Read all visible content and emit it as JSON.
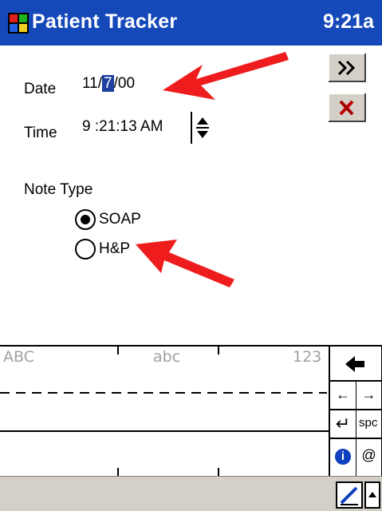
{
  "titlebar": {
    "title": "Patient Tracker",
    "clock": "9:21a",
    "icon": "windows-flag-icon"
  },
  "form": {
    "date_label": "Date",
    "date_month": "11/",
    "date_day": "7",
    "date_year": "/00",
    "time_label": "Time",
    "time_value": "9 :21:13 AM",
    "note_type_label": "Note Type",
    "note_types": [
      {
        "label": "SOAP",
        "selected": true
      },
      {
        "label": "H&P",
        "selected": false
      }
    ]
  },
  "toolbar": {
    "next_icon": "double-chevron-right-icon",
    "cancel_icon": "red-x-icon"
  },
  "input_panel": {
    "mode_labels": [
      "ABC",
      "abc",
      "123"
    ],
    "keys": {
      "backspace": "◆",
      "left": "←",
      "right": "→",
      "enter": "↵",
      "space": "spc",
      "info": "i",
      "at": "@"
    }
  },
  "colors": {
    "titlebar": "#1548b8",
    "selection": "#1d3fa0",
    "arrow": "#ee1c1c"
  }
}
